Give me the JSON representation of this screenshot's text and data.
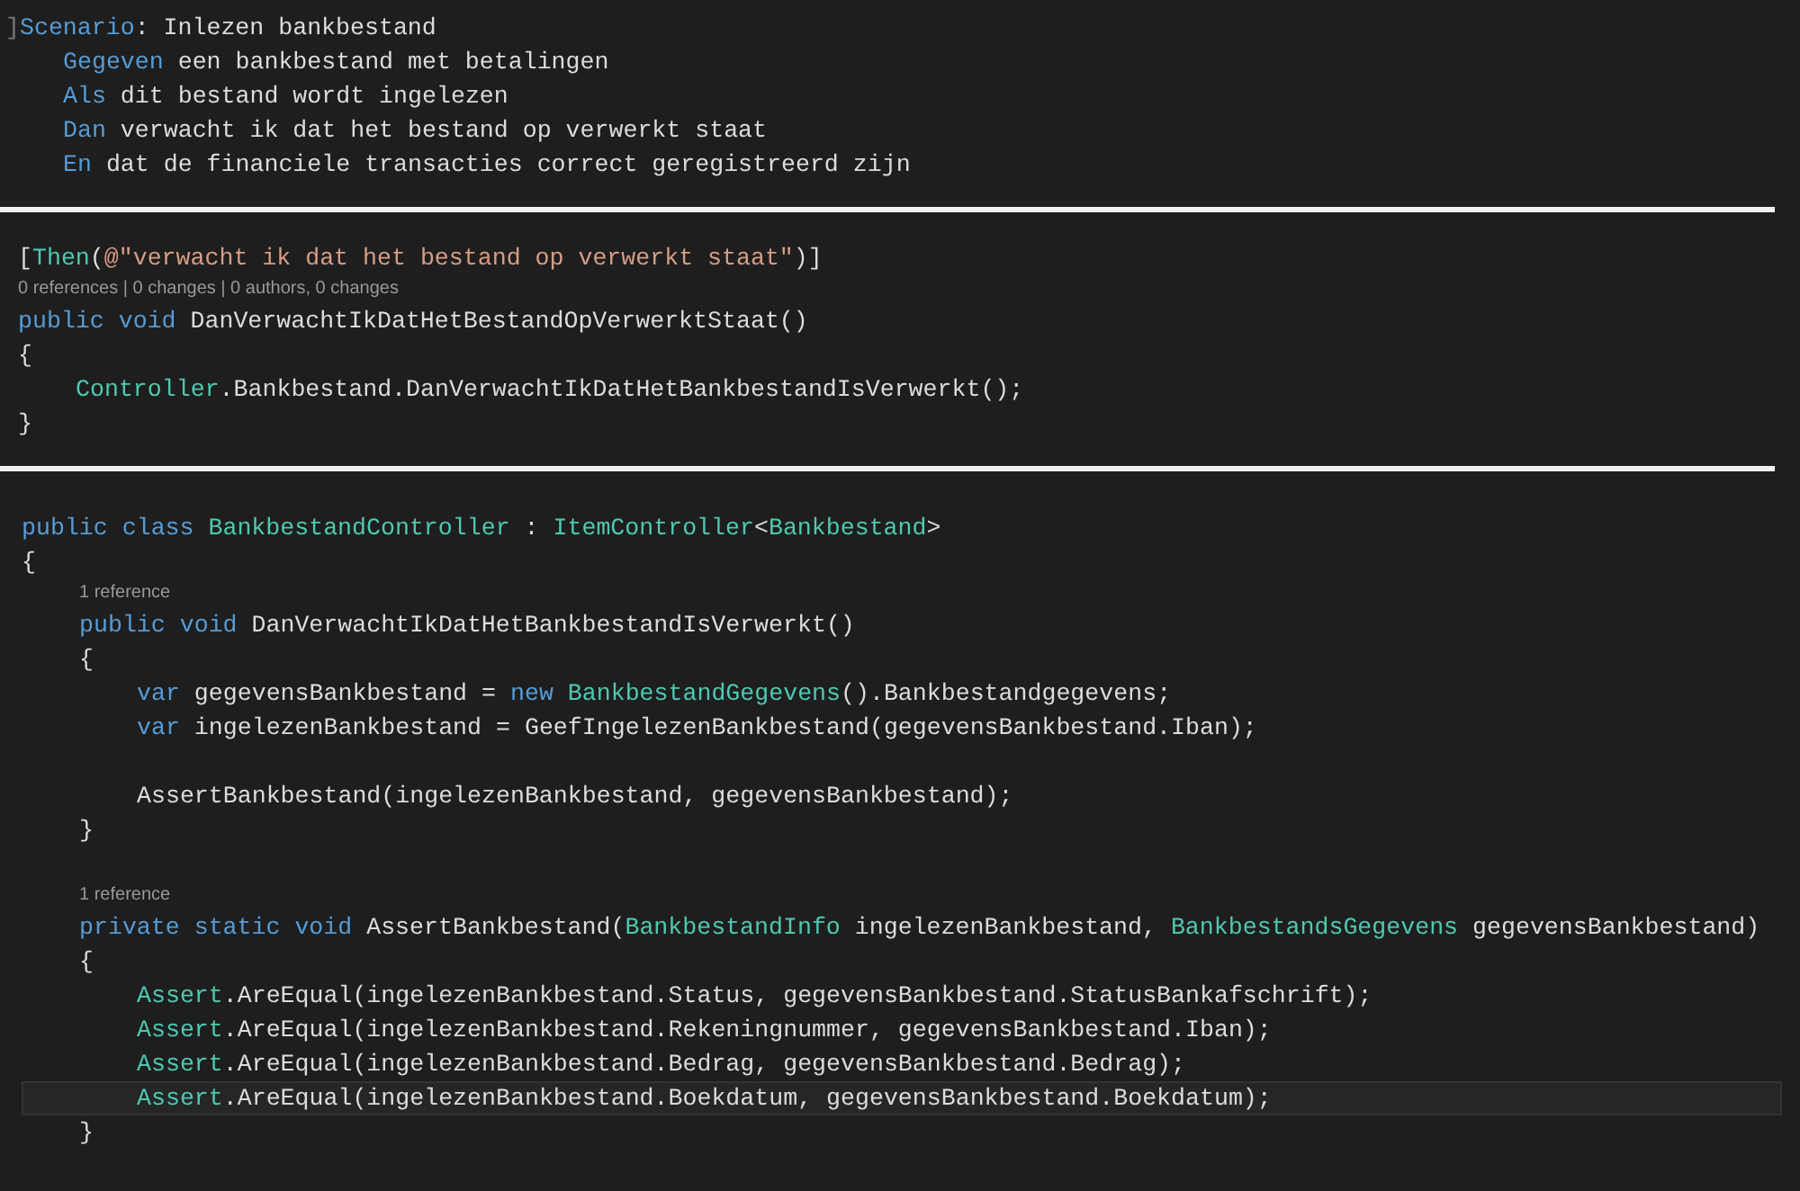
{
  "panels": [
    {
      "lines": [
        {
          "kind": "code",
          "highlighted": false,
          "tokens": [
            {
              "kind": "fold",
              "text": "]"
            },
            {
              "kind": "keyword",
              "text": "Scenario"
            },
            {
              "kind": "plain",
              "text": ": Inlezen bankbestand"
            }
          ]
        },
        {
          "kind": "block",
          "children": [
            {
              "kind": "code",
              "highlighted": false,
              "tokens": [
                {
                  "kind": "keyword",
                  "text": "Gegeven"
                },
                {
                  "kind": "plain",
                  "text": " een bankbestand met betalingen"
                }
              ]
            },
            {
              "kind": "code",
              "highlighted": false,
              "tokens": [
                {
                  "kind": "keyword",
                  "text": "Als"
                },
                {
                  "kind": "plain",
                  "text": " dit bestand wordt ingelezen"
                }
              ]
            },
            {
              "kind": "code",
              "highlighted": false,
              "tokens": [
                {
                  "kind": "keyword",
                  "text": "Dan"
                },
                {
                  "kind": "plain",
                  "text": " verwacht ik dat het bestand op verwerkt staat"
                }
              ]
            },
            {
              "kind": "code",
              "highlighted": false,
              "tokens": [
                {
                  "kind": "keyword",
                  "text": "En"
                },
                {
                  "kind": "plain",
                  "text": " dat de financiele transacties correct geregistreerd zijn"
                }
              ]
            }
          ]
        }
      ]
    },
    {
      "lines": [
        {
          "kind": "code",
          "highlighted": false,
          "tokens": [
            {
              "kind": "plain",
              "text": "["
            },
            {
              "kind": "type",
              "text": "Then"
            },
            {
              "kind": "plain",
              "text": "("
            },
            {
              "kind": "string",
              "text": "@\"verwacht ik dat het bestand op verwerkt staat\""
            },
            {
              "kind": "plain",
              "text": ")]"
            }
          ]
        },
        {
          "kind": "codelens",
          "text": "0 references | 0 changes | 0 authors, 0 changes"
        },
        {
          "kind": "code",
          "highlighted": false,
          "tokens": [
            {
              "kind": "keyword",
              "text": "public void"
            },
            {
              "kind": "plain",
              "text": " DanVerwachtIkDatHetBestandOpVerwerktStaat()"
            }
          ]
        },
        {
          "kind": "code",
          "highlighted": false,
          "tokens": [
            {
              "kind": "plain",
              "text": "{"
            }
          ]
        },
        {
          "kind": "block",
          "children": [
            {
              "kind": "code",
              "highlighted": false,
              "tokens": [
                {
                  "kind": "type",
                  "text": "Controller"
                },
                {
                  "kind": "plain",
                  "text": ".Bankbestand.DanVerwachtIkDatHetBankbestandIsVerwerkt();"
                }
              ]
            }
          ]
        },
        {
          "kind": "code",
          "highlighted": false,
          "tokens": [
            {
              "kind": "plain",
              "text": "}"
            }
          ]
        }
      ]
    },
    {
      "lines": [
        {
          "kind": "code",
          "highlighted": false,
          "tokens": [
            {
              "kind": "keyword",
              "text": "public class "
            },
            {
              "kind": "type",
              "text": "BankbestandController"
            },
            {
              "kind": "plain",
              "text": " : "
            },
            {
              "kind": "type",
              "text": "ItemController"
            },
            {
              "kind": "plain",
              "text": "<"
            },
            {
              "kind": "type",
              "text": "Bankbestand"
            },
            {
              "kind": "plain",
              "text": ">"
            }
          ]
        },
        {
          "kind": "code",
          "highlighted": false,
          "tokens": [
            {
              "kind": "plain",
              "text": "{"
            }
          ]
        },
        {
          "kind": "block",
          "children": [
            {
              "kind": "codelens",
              "text": "1 reference"
            },
            {
              "kind": "code",
              "highlighted": false,
              "tokens": [
                {
                  "kind": "keyword",
                  "text": "public void"
                },
                {
                  "kind": "plain",
                  "text": " DanVerwachtIkDatHetBankbestandIsVerwerkt()"
                }
              ]
            },
            {
              "kind": "code",
              "highlighted": false,
              "tokens": [
                {
                  "kind": "plain",
                  "text": "{"
                }
              ]
            },
            {
              "kind": "block",
              "children": [
                {
                  "kind": "code",
                  "highlighted": false,
                  "tokens": [
                    {
                      "kind": "keyword",
                      "text": "var"
                    },
                    {
                      "kind": "plain",
                      "text": " gegevensBankbestand = "
                    },
                    {
                      "kind": "keyword",
                      "text": "new "
                    },
                    {
                      "kind": "type",
                      "text": "BankbestandGegevens"
                    },
                    {
                      "kind": "plain",
                      "text": "().Bankbestandgegevens;"
                    }
                  ]
                },
                {
                  "kind": "code",
                  "highlighted": false,
                  "tokens": [
                    {
                      "kind": "keyword",
                      "text": "var"
                    },
                    {
                      "kind": "plain",
                      "text": " ingelezenBankbestand = GeefIngelezenBankbestand(gegevensBankbestand.Iban);"
                    }
                  ]
                },
                {
                  "kind": "blank"
                },
                {
                  "kind": "code",
                  "highlighted": false,
                  "tokens": [
                    {
                      "kind": "plain",
                      "text": "AssertBankbestand(ingelezenBankbestand, gegevensBankbestand);"
                    }
                  ]
                }
              ]
            },
            {
              "kind": "code",
              "highlighted": false,
              "tokens": [
                {
                  "kind": "plain",
                  "text": "}"
                }
              ]
            },
            {
              "kind": "blank"
            },
            {
              "kind": "codelens",
              "text": "1 reference"
            },
            {
              "kind": "code",
              "highlighted": false,
              "tokens": [
                {
                  "kind": "keyword",
                  "text": "private static void"
                },
                {
                  "kind": "plain",
                  "text": " AssertBankbestand("
                },
                {
                  "kind": "type",
                  "text": "BankbestandInfo"
                },
                {
                  "kind": "plain",
                  "text": " ingelezenBankbestand, "
                },
                {
                  "kind": "type",
                  "text": "BankbestandsGegevens"
                },
                {
                  "kind": "plain",
                  "text": " gegevensBankbestand)"
                }
              ]
            },
            {
              "kind": "code",
              "highlighted": false,
              "tokens": [
                {
                  "kind": "plain",
                  "text": "{"
                }
              ]
            },
            {
              "kind": "block",
              "children": [
                {
                  "kind": "code",
                  "highlighted": false,
                  "tokens": [
                    {
                      "kind": "type",
                      "text": "Assert"
                    },
                    {
                      "kind": "plain",
                      "text": ".AreEqual(ingelezenBankbestand.Status, gegevensBankbestand.StatusBankafschrift);"
                    }
                  ]
                },
                {
                  "kind": "code",
                  "highlighted": false,
                  "tokens": [
                    {
                      "kind": "type",
                      "text": "Assert"
                    },
                    {
                      "kind": "plain",
                      "text": ".AreEqual(ingelezenBankbestand.Rekeningnummer, gegevensBankbestand.Iban);"
                    }
                  ]
                },
                {
                  "kind": "code",
                  "highlighted": false,
                  "tokens": [
                    {
                      "kind": "type",
                      "text": "Assert"
                    },
                    {
                      "kind": "plain",
                      "text": ".AreEqual(ingelezenBankbestand.Bedrag, gegevensBankbestand.Bedrag);"
                    }
                  ]
                },
                {
                  "kind": "code",
                  "highlighted": true,
                  "tokens": [
                    {
                      "kind": "type",
                      "text": "Assert"
                    },
                    {
                      "kind": "plain",
                      "text": ".AreEqual(ingelezenBankbestand.Boekdatum, gegevensBankbestand.Boekdatum);"
                    }
                  ]
                }
              ]
            },
            {
              "kind": "code",
              "highlighted": false,
              "tokens": [
                {
                  "kind": "plain",
                  "text": "}"
                }
              ]
            }
          ]
        }
      ]
    }
  ]
}
